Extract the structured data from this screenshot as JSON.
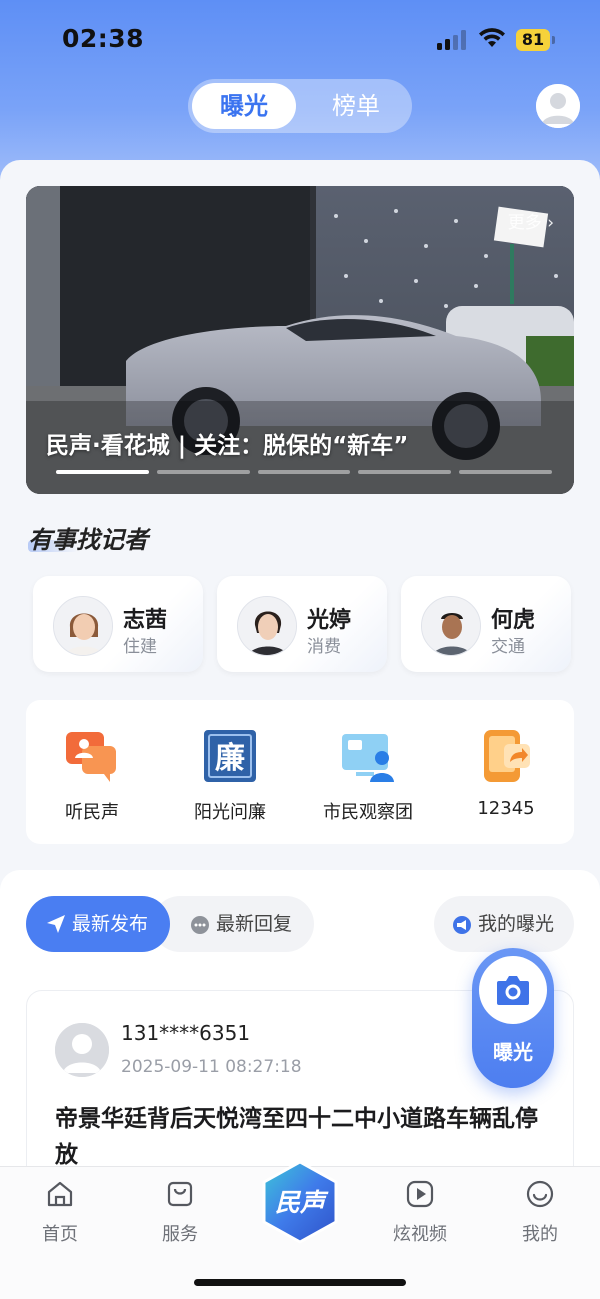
{
  "status_bar": {
    "time": "02:38",
    "battery": "81"
  },
  "header": {
    "tabs": [
      {
        "label": "曝光"
      },
      {
        "label": "榜单"
      }
    ]
  },
  "banner": {
    "title": "民声·看花城 | 关注：脱保的“新车”",
    "more": "更多 ›",
    "dot_count": 5,
    "active_dot": 0
  },
  "reporters_section": {
    "title": "有事找记者",
    "items": [
      {
        "name": "志茜",
        "tag": "住建"
      },
      {
        "name": "光婷",
        "tag": "消费"
      },
      {
        "name": "何虎",
        "tag": "交通"
      }
    ]
  },
  "quick_menu": {
    "items": [
      {
        "label": "听民声",
        "icon": "chat-people-icon"
      },
      {
        "label": "阳光问廉",
        "icon": "lian-icon",
        "glyph": "廉"
      },
      {
        "label": "市民观察团",
        "icon": "observer-icon"
      },
      {
        "label": "12345",
        "icon": "phone-share-icon"
      }
    ]
  },
  "feed": {
    "tabs": [
      {
        "label": "最新发布"
      },
      {
        "label": "最新回复"
      }
    ],
    "my_exposure": "我的曝光",
    "posts": [
      {
        "user": "131****6351",
        "time": "2025-09-11 08:27:18",
        "title": "帝景华廷背后天悦湾至四十二中小道路车辆乱停放"
      }
    ]
  },
  "fab": {
    "label": "曝光"
  },
  "tabbar": {
    "items": [
      {
        "label": "首页"
      },
      {
        "label": "服务"
      },
      {
        "label": "民声"
      },
      {
        "label": "炫视频"
      },
      {
        "label": "我的"
      }
    ]
  },
  "colors": {
    "accent": "#4a7ef2",
    "header_gradient_top": "#5e8ff5",
    "battery": "#f6d23a"
  }
}
